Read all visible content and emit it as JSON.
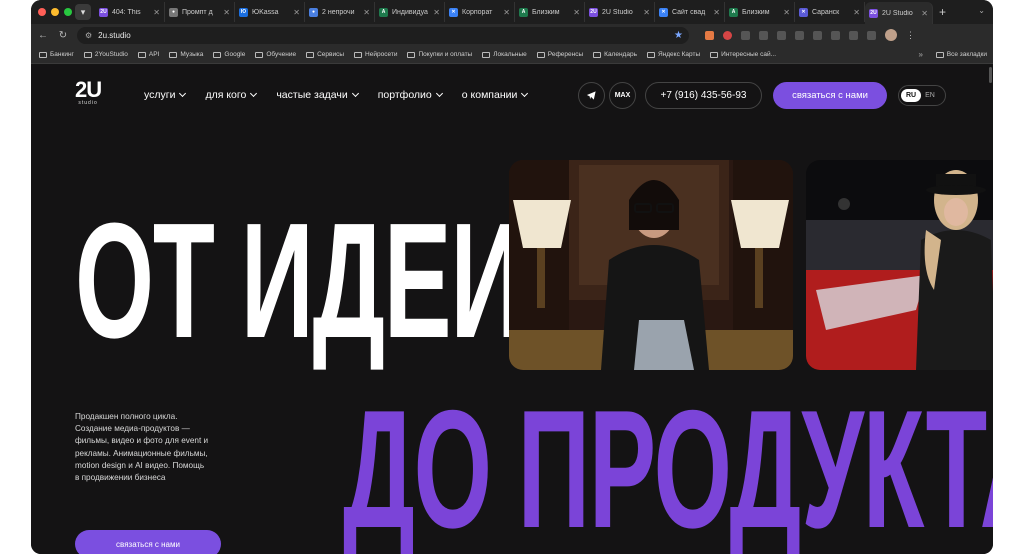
{
  "browser": {
    "tabs": [
      {
        "title": "404: This",
        "favicon": "2U",
        "color": "#7b4fe0",
        "active": false
      },
      {
        "title": "Промпт д",
        "favicon": "●",
        "color": "#777777",
        "active": false
      },
      {
        "title": "ЮKassa",
        "favicon": "Ю",
        "color": "#1b6fe0",
        "active": false
      },
      {
        "title": "2 непрочи",
        "favicon": "●",
        "color": "#4a7fe0",
        "active": false
      },
      {
        "title": "Индивидуа",
        "favicon": "A",
        "color": "#1f7a4d",
        "active": false
      },
      {
        "title": "Корпорат",
        "favicon": "✕",
        "color": "#3b82f6",
        "active": false
      },
      {
        "title": "Близким",
        "favicon": "A",
        "color": "#1f7a4d",
        "active": false
      },
      {
        "title": "2U Studio",
        "favicon": "2U",
        "color": "#7b4fe0",
        "active": false
      },
      {
        "title": "Сайт свад",
        "favicon": "✕",
        "color": "#3b82f6",
        "active": false
      },
      {
        "title": "Близким",
        "favicon": "A",
        "color": "#1f7a4d",
        "active": false
      },
      {
        "title": "Саранск",
        "favicon": "✕",
        "color": "#5b5bd6",
        "active": false
      },
      {
        "title": "2U Studio",
        "favicon": "2U",
        "color": "#7b4fe0",
        "active": true
      }
    ],
    "new_tab": "+",
    "url": "2u.studio",
    "bookmarks": [
      "Банкинг",
      "2YouStudio",
      "API",
      "Музыка",
      "Google",
      "Обучение",
      "Сервисы",
      "Нейросети",
      "Покупки и оплаты",
      "Локальные",
      "Референсы",
      "Календарь",
      "Яндекс Карты",
      "Интересные сай..."
    ],
    "bookmarks_more": "»",
    "all_bookmarks": "Все закладки"
  },
  "site": {
    "logo": "2U",
    "logo_sub": "studio",
    "menu": [
      "услуги",
      "для кого",
      "частые задачи",
      "портфолио",
      "о компании"
    ],
    "max_label": "MAX",
    "phone": "+7 (916) 435-56-93",
    "cta_top": "связаться с нами",
    "lang_active": "RU",
    "lang_other": "EN",
    "hero_line1": "ОТ ИДЕИ",
    "hero_line2": "ДО ПРОДУКТА",
    "description": "Продакшен полного цикла. Создание медиа-продуктов — фильмы, видео и фото для event и рекламы. Анимационные фильмы, motion design и AI видео. Помощь в продвижении бизнеса",
    "cta_bottom": "связаться с нами"
  },
  "colors": {
    "accent": "#7b4fe0",
    "hero_purple": "#7b44d8",
    "page_bg": "#141314"
  }
}
